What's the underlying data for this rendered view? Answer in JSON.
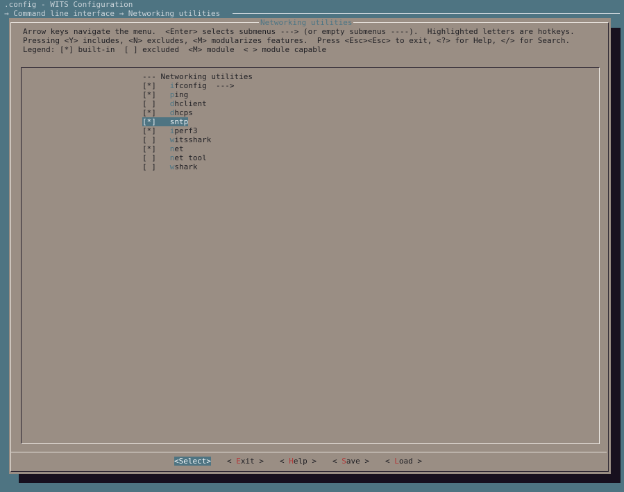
{
  "header": {
    "title": ".config - WITS Configuration",
    "breadcrumb": "→ Command line interface → Networking utilities"
  },
  "dialog": {
    "title": "Networking utilities",
    "help_lines": [
      "Arrow keys navigate the menu.  <Enter> selects submenus ---> (or empty submenus ----).  Highlighted letters are hotkeys.",
      "Pressing <Y> includes, <N> excludes, <M> modularizes features.  Press <Esc><Esc> to exit, <?> for Help, </> for Search.",
      "Legend: [*] built-in  [ ] excluded  <M> module  < > module capable"
    ]
  },
  "menu": {
    "heading": "--- Networking utilities",
    "items": [
      {
        "state": "[*]",
        "hotkey": "i",
        "rest": "fconfig",
        "suffix": "  --->",
        "selected": false
      },
      {
        "state": "[*]",
        "hotkey": "p",
        "rest": "ing",
        "suffix": "",
        "selected": false
      },
      {
        "state": "[ ]",
        "hotkey": "d",
        "rest": "hclient",
        "suffix": "",
        "selected": false
      },
      {
        "state": "[*]",
        "hotkey": "d",
        "rest": "hcps",
        "suffix": "",
        "selected": false
      },
      {
        "state": "[*]",
        "hotkey": "s",
        "rest": "ntp",
        "suffix": "",
        "selected": true
      },
      {
        "state": "[*]",
        "hotkey": "i",
        "rest": "perf3",
        "suffix": "",
        "selected": false
      },
      {
        "state": "[ ]",
        "hotkey": "w",
        "rest": "itsshark",
        "suffix": "",
        "selected": false
      },
      {
        "state": "[*]",
        "hotkey": "n",
        "rest": "et",
        "suffix": "",
        "selected": false
      },
      {
        "state": "[ ]",
        "hotkey": "n",
        "rest": "et tool",
        "suffix": "",
        "selected": false
      },
      {
        "state": "[ ]",
        "hotkey": "w",
        "rest": "shark",
        "suffix": "",
        "selected": false
      }
    ]
  },
  "buttons": [
    {
      "pre": "<",
      "hotkey": "S",
      "rest": "elect",
      "post": ">",
      "active": true
    },
    {
      "pre": "< ",
      "hotkey": "E",
      "rest": "xit",
      "post": " >",
      "active": false
    },
    {
      "pre": "< ",
      "hotkey": "H",
      "rest": "elp",
      "post": " >",
      "active": false
    },
    {
      "pre": "< ",
      "hotkey": "S",
      "rest": "ave",
      "post": " >",
      "active": false
    },
    {
      "pre": "< ",
      "hotkey": "L",
      "rest": "oad",
      "post": " >",
      "active": false
    }
  ],
  "colors": {
    "background": "#4e7482",
    "dialog": "#9a8e84",
    "hotkey": "#4c7585",
    "button_hotkey": "#b23a3a"
  }
}
